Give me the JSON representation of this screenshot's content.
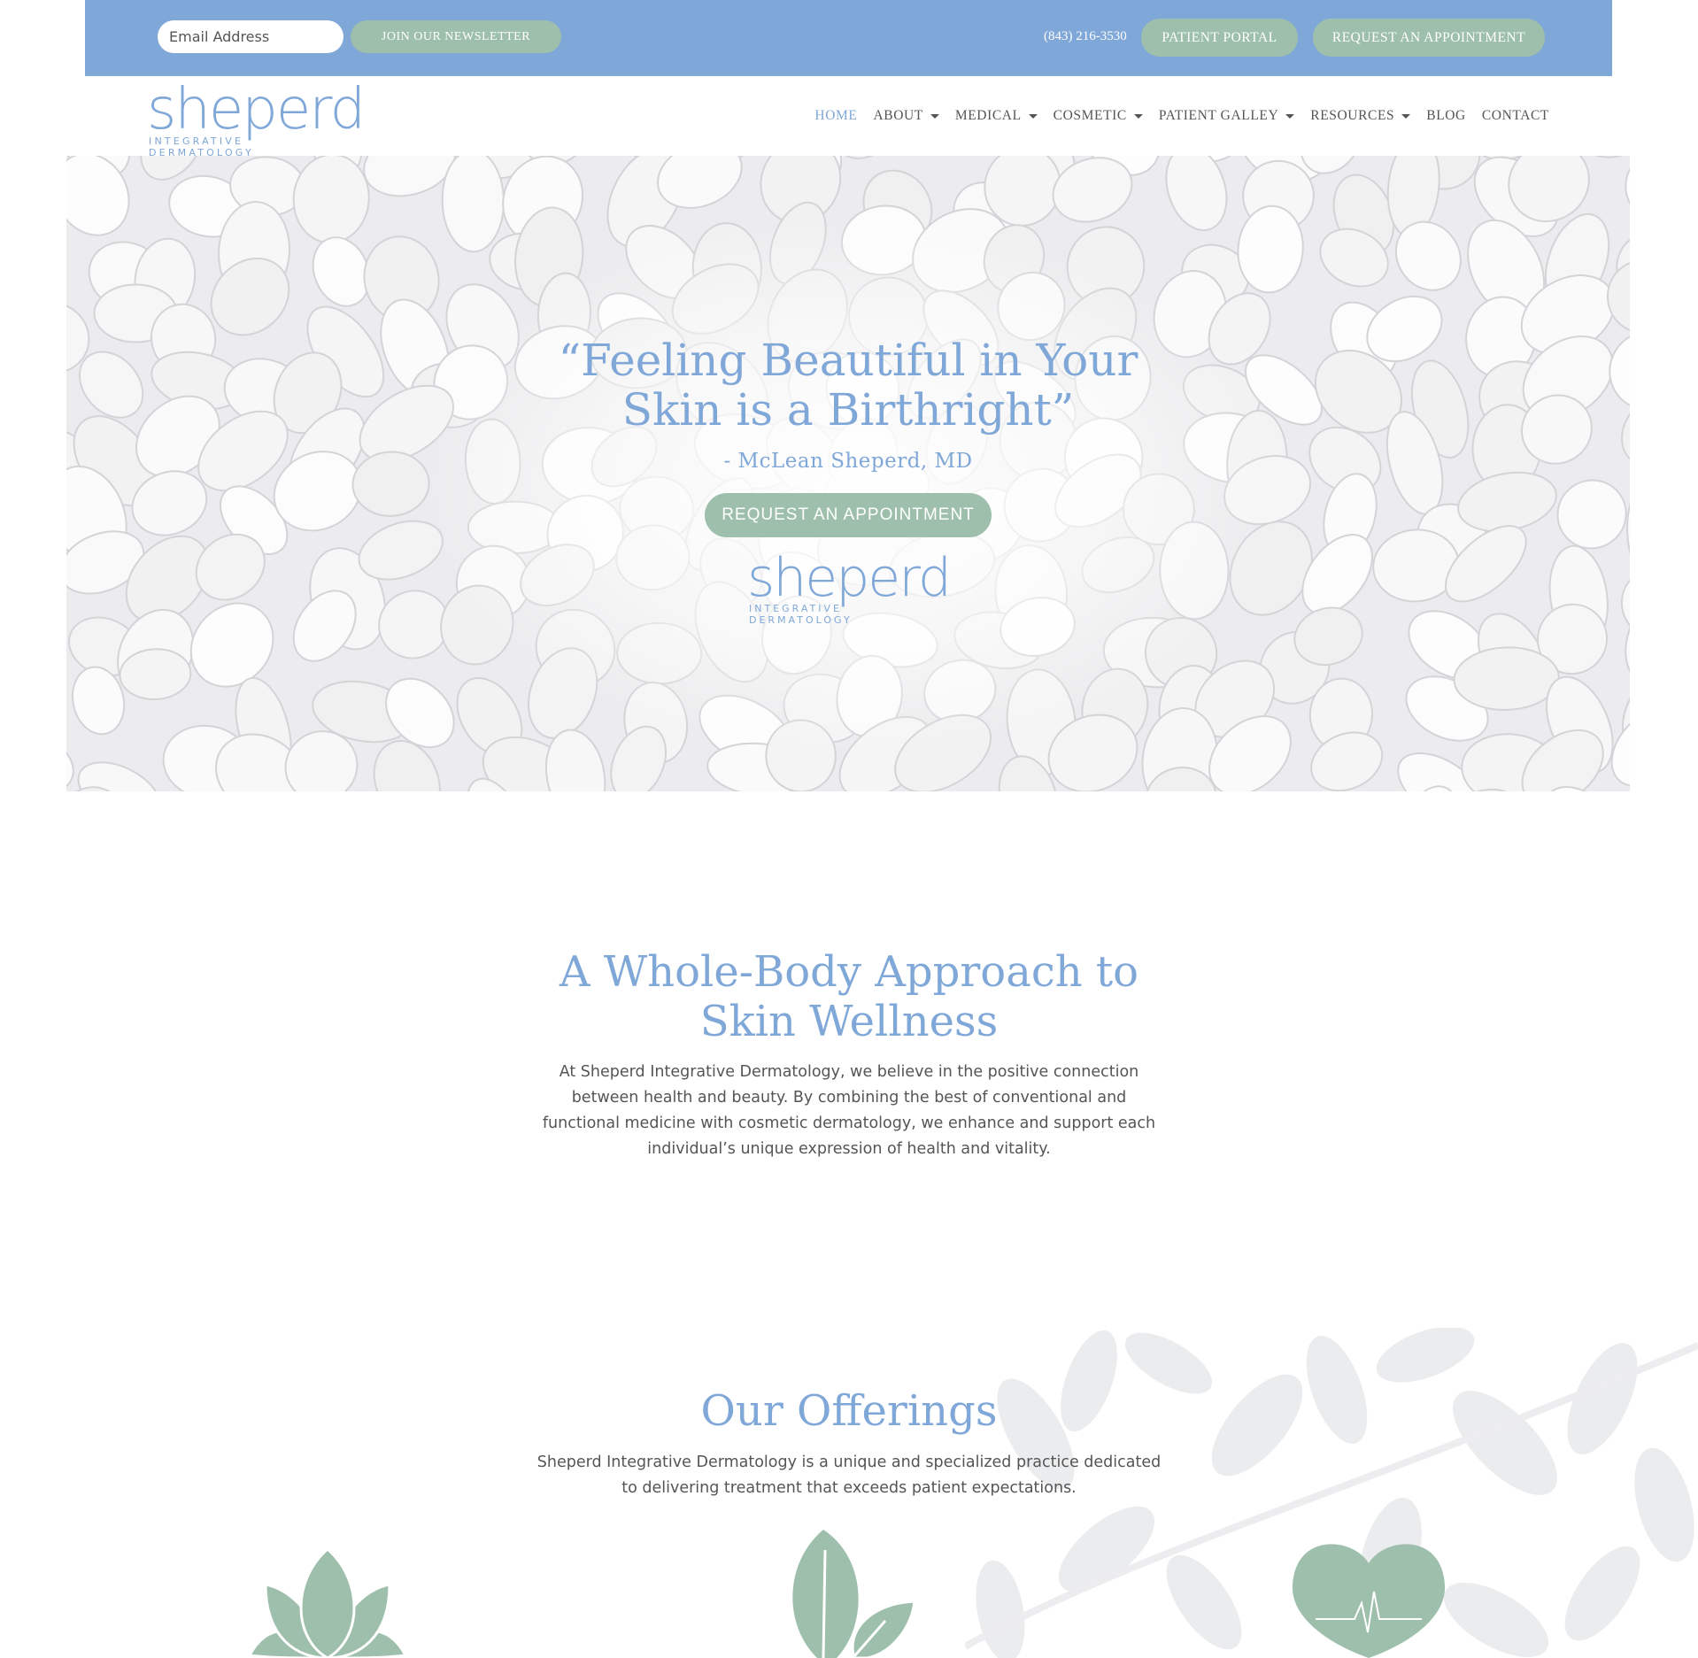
{
  "topbar": {
    "email_placeholder": "Email Address",
    "newsletter_label": "JOIN OUR NEWSLETTER",
    "phone": "(843) 216-3530",
    "portal_label": "PATIENT PORTAL",
    "appointment_label": "REQUEST AN APPOINTMENT"
  },
  "logo": {
    "word": "sheperd",
    "subtitle": "INTEGRATIVE DERMATOLOGY"
  },
  "nav": {
    "items": [
      {
        "label": "HOME",
        "active": true,
        "dropdown": false
      },
      {
        "label": "ABOUT",
        "dropdown": true
      },
      {
        "label": "MEDICAL",
        "dropdown": true
      },
      {
        "label": "COSMETIC",
        "dropdown": true
      },
      {
        "label": "PATIENT GALLEY",
        "dropdown": true
      },
      {
        "label": "RESOURCES",
        "dropdown": true
      },
      {
        "label": "BLOG",
        "dropdown": false
      },
      {
        "label": "CONTACT",
        "dropdown": false
      }
    ]
  },
  "hero": {
    "quote_line1": "“Feeling Beautiful in Your",
    "quote_line2": "Skin is a Birthright”",
    "author": "- McLean Sheperd, MD",
    "button_label": "REQUEST AN APPOINTMENT"
  },
  "about": {
    "title_line1": "A Whole-Body Approach to",
    "title_line2": "Skin Wellness",
    "text": "At Sheperd Integrative Dermatology, we believe in the positive connection between health and beauty. By combining the best of conventional and functional medicine with cosmetic dermatology, we enhance and support each individual’s unique expression of health and vitality."
  },
  "offerings": {
    "title": "Our Offerings",
    "text": "Sheperd Integrative Dermatology is a unique and specialized practice dedicated to delivering treatment that exceeds patient expectations.",
    "icons": [
      "lotus-icon",
      "leaf-icon",
      "heart-pulse-icon"
    ]
  },
  "colors": {
    "brand_blue": "#7fa7d8",
    "sage_green": "#9dbfab",
    "body_text": "#555555"
  }
}
